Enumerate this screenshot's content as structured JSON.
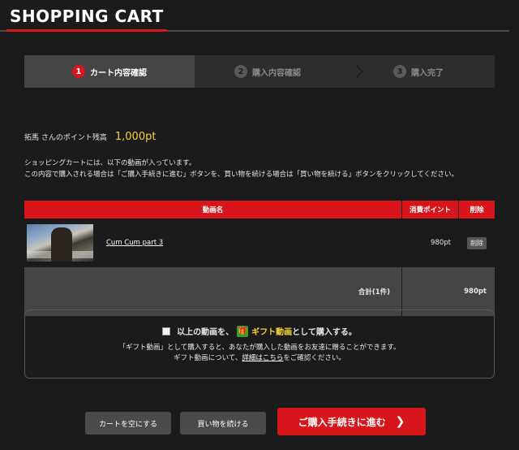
{
  "header": {
    "title": "SHOPPING CART"
  },
  "steps": [
    {
      "num": "1",
      "label": "カート内容確認"
    },
    {
      "num": "2",
      "label": "購入内容確認"
    },
    {
      "num": "3",
      "label": "購入完了"
    }
  ],
  "points": {
    "label": "拓馬 さんのポイント残高",
    "value": "1,000pt"
  },
  "intro": {
    "line1": "ショッピングカートには、以下の動画が入っています。",
    "line2": "この内容で購入される場合は「ご購入手続きに進む」ボタンを、買い物を続ける場合は「買い物を続ける」ボタンをクリックしてください。"
  },
  "table": {
    "headers": {
      "title": "動画名",
      "points": "消費ポイント",
      "delete": "削除"
    },
    "rows": [
      {
        "title": "Cum Cum part 3",
        "price": "980pt",
        "delete": "削除"
      }
    ],
    "total_label": "合計(1件)",
    "total_value": "980pt"
  },
  "gift": {
    "prefix": "以上の動画を、",
    "gift_label": "ギフト動画",
    "suffix": "として購入する。",
    "note1": "「ギフト動画」として購入すると、あなたが購入した動画をお友達に贈ることができます。",
    "note2_prefix": "ギフト動画について、",
    "note2_link": "詳細はこちら",
    "note2_suffix": "をご確認ください。"
  },
  "buttons": {
    "empty": "カートを空にする",
    "continue": "買い物を続ける",
    "proceed": "ご購入手続きに進む"
  },
  "colors": {
    "accent": "#d7161c",
    "points": "#f5d533",
    "background": "#1b1b1b"
  }
}
